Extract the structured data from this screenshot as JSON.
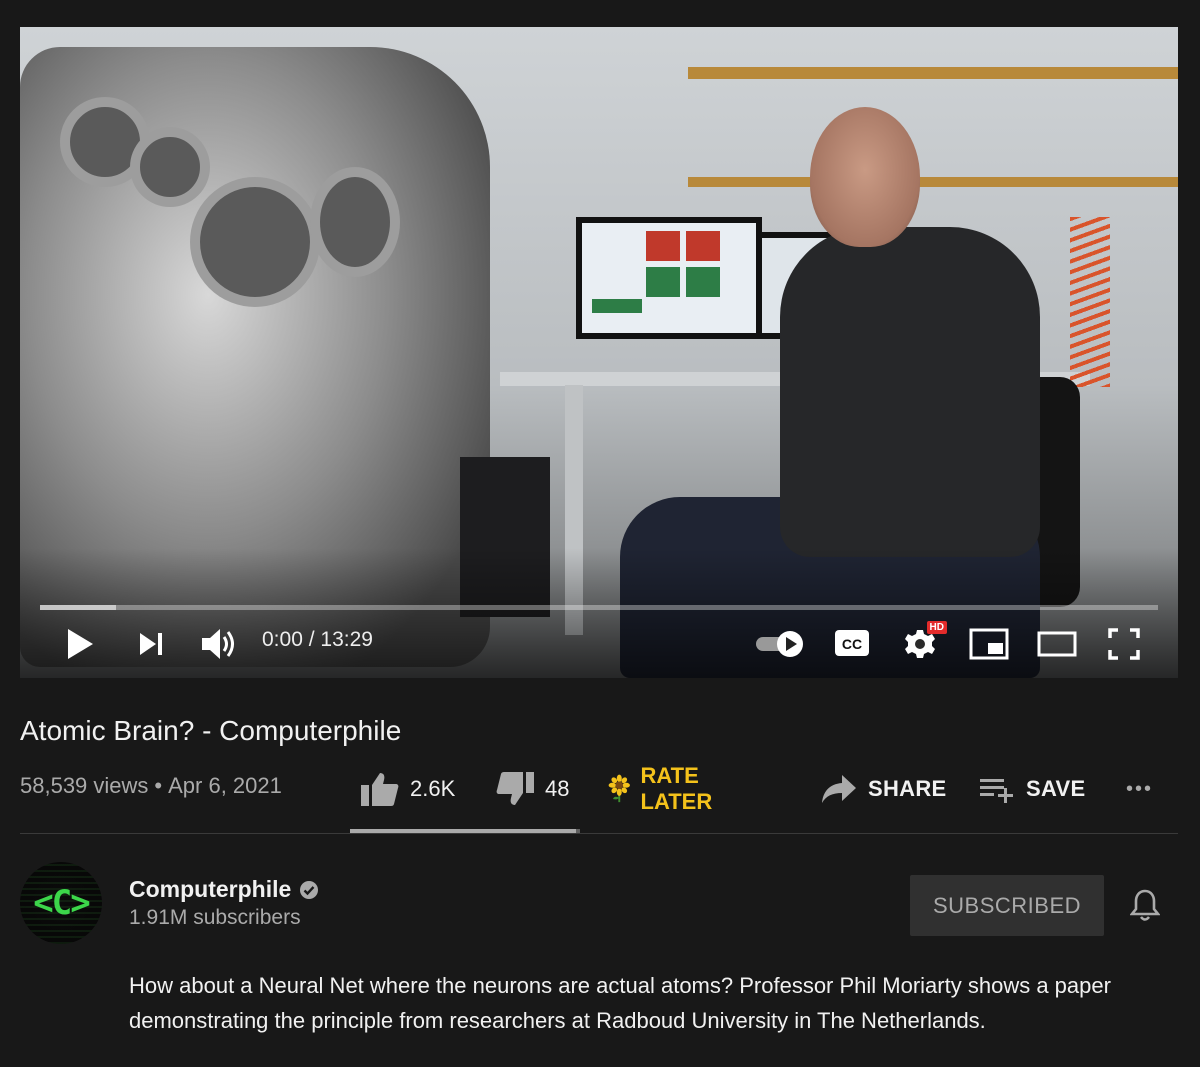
{
  "player": {
    "current_time": "0:00",
    "separator": " / ",
    "duration": "13:29",
    "progress_fraction": 0.0,
    "buffered_fraction": 0.068,
    "hd_badge": "HD",
    "icons": [
      "play-icon",
      "next-icon",
      "volume-icon",
      "autoplay-toggle-icon",
      "captions-icon",
      "settings-icon",
      "miniplayer-icon",
      "theater-icon",
      "fullscreen-icon"
    ],
    "captions_label": "CC"
  },
  "video": {
    "title": "Atomic Brain? - Computerphile",
    "views": "58,539 views",
    "dot": "•",
    "date": "Apr 6, 2021"
  },
  "actions": {
    "likes": "2.6K",
    "dislikes": "48",
    "rate_later": "RATE LATER",
    "share": "SHARE",
    "save": "SAVE",
    "more_label": "•••",
    "like_fraction": 0.982
  },
  "channel": {
    "name": "Computerphile",
    "subscribers": "1.91M subscribers",
    "avatar_mark": "<C>",
    "subscribe_button": "SUBSCRIBED"
  },
  "description": "How about a Neural Net where the neurons are actual atoms? Professor Phil Moriarty shows a paper demonstrating the principle from researchers at Radboud University in The Netherlands.",
  "colors": {
    "background": "#181818",
    "rate_later": "#f4c21b",
    "avatar_green": "#3cd64a",
    "hd_red": "#e32b2b"
  }
}
